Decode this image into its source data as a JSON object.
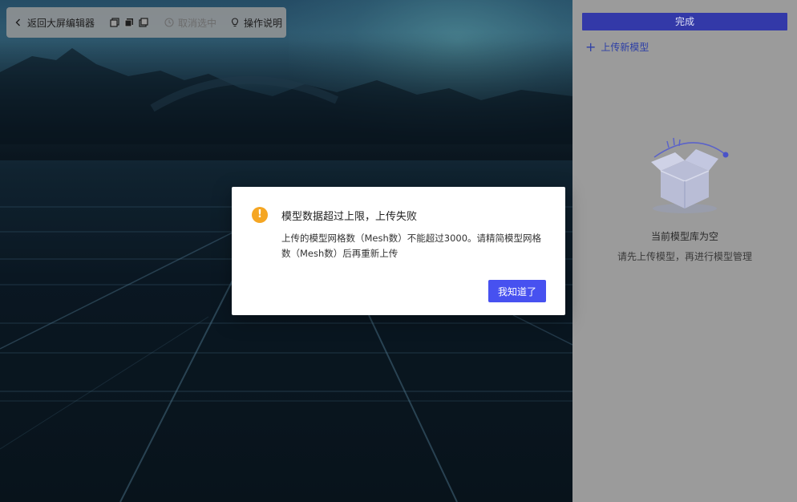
{
  "toolbar": {
    "back_label": "返回大屏编辑器",
    "cancel_select_label": "取消选中",
    "help_label": "操作说明"
  },
  "panel": {
    "done_label": "完成",
    "upload_label": "上传新模型",
    "empty_title": "当前模型库为空",
    "empty_subtitle": "请先上传模型，再进行模型管理"
  },
  "modal": {
    "title": "模型数据超过上限，上传失败",
    "description": "上传的模型网格数（Mesh数）不能超过3000。请精简模型网格数（Mesh数）后再重新上传",
    "ok_label": "我知道了"
  },
  "colors": {
    "accent": "#4751f0",
    "panel_button": "#3339a8",
    "warning": "#f5a623",
    "panel_bg": "#9b9b9b"
  },
  "icons": [
    "chevron-left-icon",
    "copy-icon",
    "layers-icon",
    "duplicate-icon",
    "clock-icon",
    "lightbulb-icon",
    "plus-icon",
    "warning-icon",
    "empty-box-illustration"
  ]
}
